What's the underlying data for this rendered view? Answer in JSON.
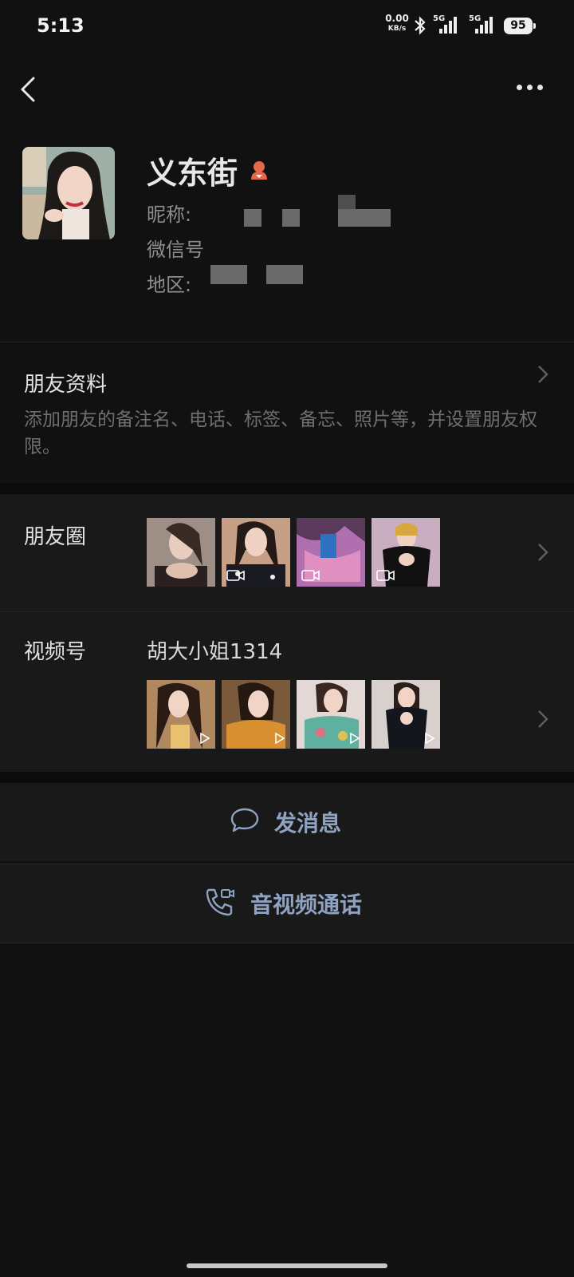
{
  "status_bar": {
    "time": "5:13",
    "net_speed_value": "0.00",
    "net_speed_unit": "KB/s",
    "signal1_label": "5G",
    "signal2_label": "5G",
    "battery": "95"
  },
  "profile": {
    "name": "义东街",
    "nickname_label": "昵称: ",
    "wechat_id_label": "微信号",
    "region_label": "地区: "
  },
  "friend_info": {
    "title": "朋友资料",
    "description": "添加朋友的备注名、电话、标签、备忘、照片等，并设置朋友权限。"
  },
  "moments": {
    "label": "朋友圈",
    "thumbnails": [
      {
        "icon": "photo",
        "video": false
      },
      {
        "icon": "photo",
        "video": true
      },
      {
        "icon": "photo",
        "video": true
      },
      {
        "icon": "photo",
        "video": true
      }
    ]
  },
  "channels": {
    "label": "视频号",
    "name": "胡大小姐1314",
    "thumbnails": [
      {
        "icon": "play-icon"
      },
      {
        "icon": "play-icon"
      },
      {
        "icon": "play-icon"
      },
      {
        "icon": "play-icon"
      }
    ]
  },
  "actions": {
    "message": "发消息",
    "call": "音视频通话"
  },
  "colors": {
    "background": "#111111",
    "row_background": "#191919",
    "action_text": "#8ea2c2",
    "gender_female": "#e5684a"
  }
}
